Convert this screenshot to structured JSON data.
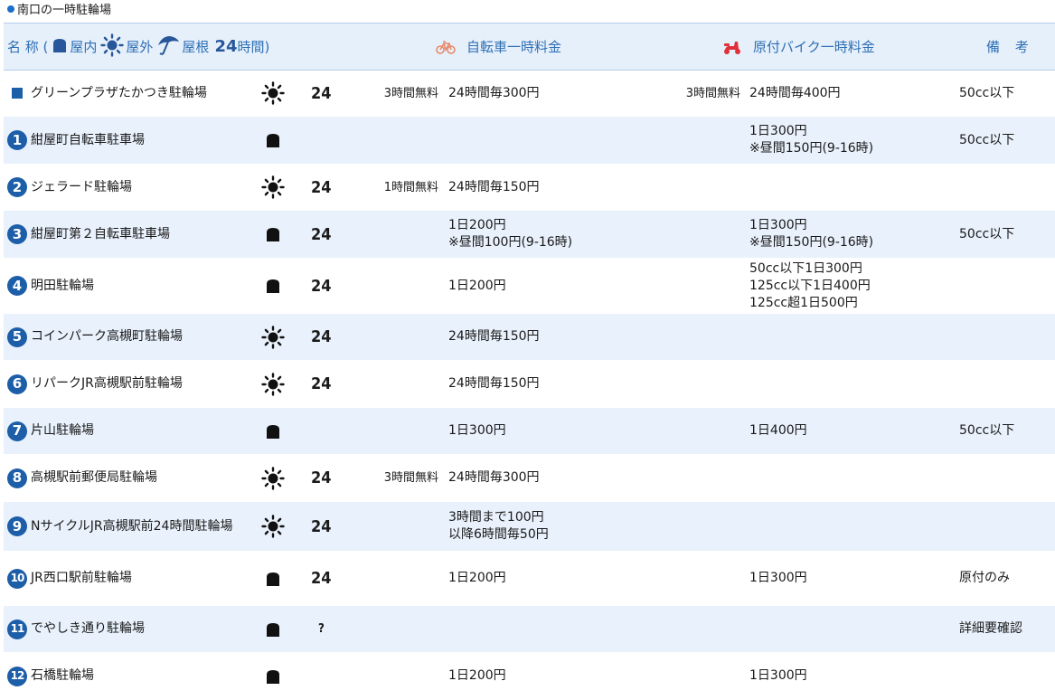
{
  "section_title": "南口の一時駐輪場",
  "header": {
    "name_label": "名 称 (",
    "indoor_label": "屋内",
    "outdoor_label": "屋外",
    "roof_label": "屋根",
    "h24_label": "24",
    "time_label": "時間)",
    "bike_label": "自転車一時料金",
    "moto_label": "原付バイク一時料金",
    "note_label": "備 考"
  },
  "rows": [
    {
      "num": "",
      "name": "グリーンプラザたかつき駐輪場",
      "type": "outdoor",
      "h24": "24",
      "bike_free": "3時間無料",
      "bike_fee": [
        "24時間毎300円"
      ],
      "moto_free": "3時間無料",
      "moto_fee": [
        "24時間毎400円"
      ],
      "note": "50cc以下"
    },
    {
      "num": "1",
      "name": "紺屋町自転車駐車場",
      "type": "indoor",
      "h24": "",
      "bike_free": "",
      "bike_fee": [],
      "moto_free": "",
      "moto_fee": [
        "1日300円",
        "※昼間150円(9-16時)"
      ],
      "note": "50cc以下"
    },
    {
      "num": "2",
      "name": "ジェラード駐輪場",
      "type": "outdoor",
      "h24": "24",
      "bike_free": "1時間無料",
      "bike_fee": [
        "24時間毎150円"
      ],
      "moto_free": "",
      "moto_fee": [],
      "note": ""
    },
    {
      "num": "3",
      "name": "紺屋町第２自転車駐車場",
      "type": "indoor",
      "h24": "24",
      "bike_free": "",
      "bike_fee": [
        "1日200円",
        "※昼間100円(9-16時)"
      ],
      "moto_free": "",
      "moto_fee": [
        "1日300円",
        "※昼間150円(9-16時)"
      ],
      "note": "50cc以下"
    },
    {
      "num": "4",
      "name": "明田駐輪場",
      "type": "indoor",
      "h24": "24",
      "bike_free": "",
      "bike_fee": [
        "1日200円"
      ],
      "moto_free": "",
      "moto_fee": [
        "50cc以下1日300円",
        "125cc以下1日400円",
        "125cc超1日500円"
      ],
      "note": ""
    },
    {
      "num": "5",
      "name": "コインパーク高槻町駐輪場",
      "type": "outdoor",
      "h24": "24",
      "bike_free": "",
      "bike_fee": [
        "24時間毎150円"
      ],
      "moto_free": "",
      "moto_fee": [],
      "note": ""
    },
    {
      "num": "6",
      "name": "リパークJR高槻駅前駐輪場",
      "type": "outdoor",
      "h24": "24",
      "bike_free": "",
      "bike_fee": [
        "24時間毎150円"
      ],
      "moto_free": "",
      "moto_fee": [],
      "note": ""
    },
    {
      "num": "7",
      "name": "片山駐輪場",
      "type": "indoor",
      "h24": "",
      "bike_free": "",
      "bike_fee": [
        "1日300円"
      ],
      "moto_free": "",
      "moto_fee": [
        "1日400円"
      ],
      "note": "50cc以下"
    },
    {
      "num": "8",
      "name": "高槻駅前郵便局駐輪場",
      "type": "outdoor",
      "h24": "24",
      "bike_free": "3時間無料",
      "bike_fee": [
        "24時間毎300円"
      ],
      "moto_free": "",
      "moto_fee": [],
      "note": ""
    },
    {
      "num": "9",
      "name": "NサイクルJR高槻駅前24時間駐輪場",
      "type": "outdoor",
      "h24": "24",
      "bike_free": "",
      "bike_fee": [
        "3時間まで100円",
        "以降6時間毎50円"
      ],
      "moto_free": "",
      "moto_fee": [],
      "note": ""
    },
    {
      "num": "10",
      "name": "JR西口駅前駐輪場",
      "type": "indoor",
      "h24": "24",
      "bike_free": "",
      "bike_fee": [
        "1日200円"
      ],
      "moto_free": "",
      "moto_fee": [
        "1日300円"
      ],
      "note": "原付のみ"
    },
    {
      "num": "11",
      "name": "でやしき通り駐輪場",
      "type": "indoor",
      "h24": "?",
      "bike_free": "",
      "bike_fee": [],
      "moto_free": "",
      "moto_fee": [],
      "note": "詳細要確認"
    },
    {
      "num": "12",
      "name": "石橋駐輪場",
      "type": "indoor",
      "h24": "",
      "bike_free": "",
      "bike_fee": [
        "1日200円"
      ],
      "moto_free": "",
      "moto_fee": [
        "1日300円"
      ],
      "note": ""
    }
  ],
  "colors": {
    "accent": "#1d5ea8",
    "header_bg": "#e6f0fb",
    "row_shade": "#e8f1fc",
    "bike_icon": "#e88a6a",
    "moto_icon": "#e0303a"
  }
}
